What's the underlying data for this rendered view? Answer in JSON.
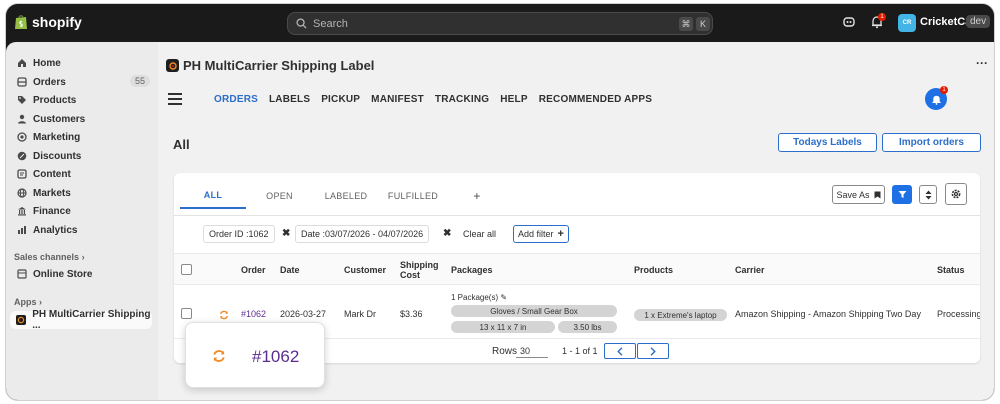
{
  "topbar": {
    "brand": "shopify",
    "search_placeholder": "Search",
    "shortcut_keys": [
      "⌘",
      "K"
    ],
    "notification_count": "1",
    "store_initials": "CR",
    "store_name": "CricketCart",
    "store_badge": "dev"
  },
  "sidebar": {
    "items": [
      {
        "label": "Home",
        "icon": "home-icon"
      },
      {
        "label": "Orders",
        "icon": "orders-icon",
        "count": "55"
      },
      {
        "label": "Products",
        "icon": "tag-icon"
      },
      {
        "label": "Customers",
        "icon": "person-icon"
      },
      {
        "label": "Marketing",
        "icon": "target-icon"
      },
      {
        "label": "Discounts",
        "icon": "discount-icon"
      },
      {
        "label": "Content",
        "icon": "content-icon"
      },
      {
        "label": "Markets",
        "icon": "globe-icon"
      },
      {
        "label": "Finance",
        "icon": "bank-icon"
      },
      {
        "label": "Analytics",
        "icon": "chart-icon"
      }
    ],
    "sales_channels_label": "Sales channels",
    "online_store_label": "Online Store",
    "apps_label": "Apps",
    "app_item_label": "PH MultiCarrier Shipping ..."
  },
  "app": {
    "title": "PH MultiCarrier Shipping Label",
    "nav": [
      "ORDERS",
      "LABELS",
      "PICKUP",
      "MANIFEST",
      "TRACKING",
      "HELP",
      "RECOMMENDED APPS"
    ],
    "active_nav": "ORDERS",
    "bell_badge": "1",
    "page_heading": "All",
    "todays_labels": "Todays Labels",
    "import_orders": "Import orders"
  },
  "tabs": {
    "items": [
      "ALL",
      "OPEN",
      "LABELED",
      "FULFILLED"
    ],
    "active": "ALL",
    "add": "+",
    "save_as": "Save As"
  },
  "filters": {
    "order_id": "Order ID :1062",
    "date": "Date :03/07/2026 - 04/07/2026",
    "clear_all": "Clear all",
    "add_filter": "Add filter"
  },
  "table": {
    "headers": {
      "order": "Order",
      "date": "Date",
      "customer": "Customer",
      "shipping_cost_1": "Shipping",
      "shipping_cost_2": "Cost",
      "packages": "Packages",
      "products": "Products",
      "carrier": "Carrier",
      "status": "Status"
    },
    "rows": [
      {
        "order": "#1062",
        "date": "2026-03-27",
        "customer": "Mark Dr",
        "shipping_cost": "$3.36",
        "packages_title": "1 Package(s)",
        "package_name": "Gloves / Small Gear Box",
        "package_dims": "13 x 11 x 7 in",
        "package_weight": "3.50 lbs",
        "products": "1 x Extreme's laptop",
        "carrier": "Amazon Shipping - Amazon Shipping Two Day",
        "status": "Processing"
      }
    ]
  },
  "pagination": {
    "rows_label": "Rows",
    "rows_value": "30",
    "range": "1 - 1 of 1"
  },
  "tooltip": {
    "text": "#1062"
  },
  "colors": {
    "accent": "#2c6ecb",
    "primary_button": "#1f6fe5",
    "order_link": "#5c2d91",
    "refresh_icon": "#f08a24"
  }
}
